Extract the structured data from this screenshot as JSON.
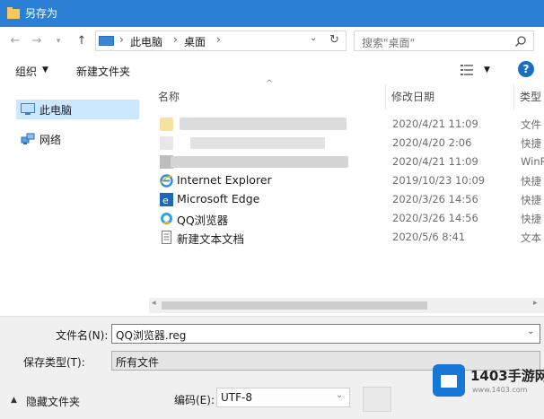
{
  "window": {
    "title": "另存为"
  },
  "address": {
    "crumbs": [
      "此电脑",
      "桌面"
    ],
    "search_placeholder": "搜索\"桌面\""
  },
  "toolbar": {
    "organize": "组织",
    "new_folder": "新建文件夹"
  },
  "nav": {
    "items": [
      {
        "label": "此电脑",
        "icon": "pc-icon"
      },
      {
        "label": "网络",
        "icon": "network-icon"
      }
    ]
  },
  "filelist": {
    "columns": [
      "名称",
      "修改日期",
      "类型"
    ],
    "rows": [
      {
        "name": "",
        "date": "2020/4/21 11:09",
        "type": "文件",
        "icon": "folder-icon"
      },
      {
        "name": "",
        "date": "2020/4/20 2:06",
        "type": "快捷",
        "icon": "blurred-icon"
      },
      {
        "name": "",
        "date": "2020/4/21 11:09",
        "type": "WinR",
        "icon": "blurred-icon"
      },
      {
        "name": "Internet Explorer",
        "date": "2019/10/23 10:09",
        "type": "快捷",
        "icon": "internet-explorer-icon"
      },
      {
        "name": "Microsoft Edge",
        "date": "2020/3/26 14:56",
        "type": "快捷",
        "icon": "edge-icon"
      },
      {
        "name": "QQ浏览器",
        "date": "2020/3/26 14:56",
        "type": "快捷",
        "icon": "qq-browser-icon"
      },
      {
        "name": "新建文本文档",
        "date": "2020/5/6 8:41",
        "type": "文本",
        "icon": "text-document-icon"
      }
    ]
  },
  "bottom": {
    "filename_label": "文件名(N):",
    "filename_value": "QQ浏览器.reg",
    "filetype_label": "保存类型(T):",
    "filetype_value": "所有文件",
    "hide_folders": "隐藏文件夹",
    "encoding_label": "编码(E):",
    "encoding_value": "UTF-8"
  },
  "watermark": {
    "text": "1403手游网",
    "sub": "www.1403.com"
  },
  "colors": {
    "titlebar": "#2b7fd4",
    "selection": "#cce8ff",
    "bottom_bg": "#f0f0f0"
  }
}
